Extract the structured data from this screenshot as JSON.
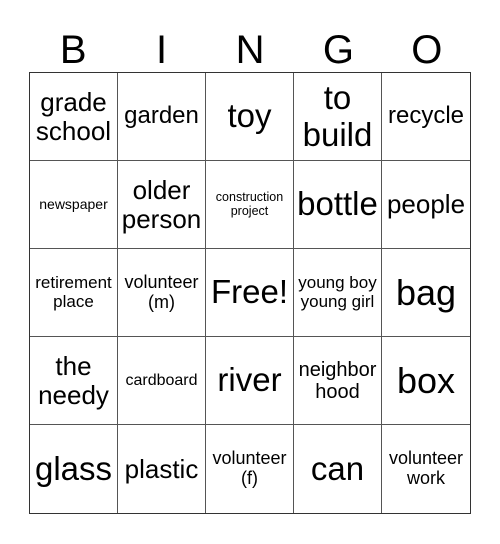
{
  "header": [
    "B",
    "I",
    "N",
    "G",
    "O"
  ],
  "cells": [
    "grade\nschool",
    "garden",
    "toy",
    "to\nbuild",
    "recycle",
    "newspaper",
    "older\nperson",
    "construction\nproject",
    "bottle",
    "people",
    "retirement\nplace",
    "volunteer\n(m)",
    "Free!",
    "young boy\nyoung girl",
    "bag",
    "the\nneedy",
    "cardboard",
    "river",
    "neighbor\nhood",
    "box",
    "glass",
    "plastic",
    "volunteer\n(f)",
    "can",
    "volunteer\nwork"
  ]
}
